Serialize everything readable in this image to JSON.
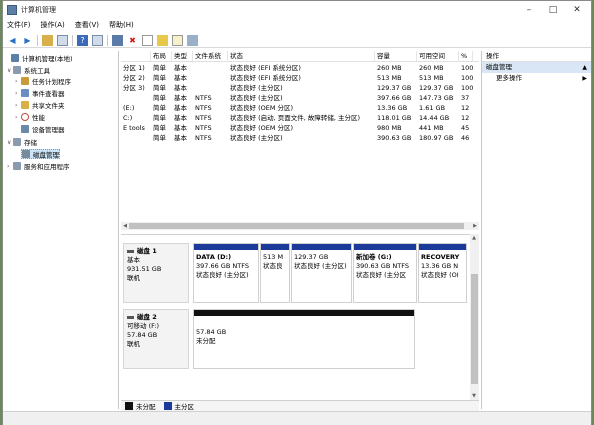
{
  "window": {
    "title": "计算机管理"
  },
  "menu": [
    "文件(F)",
    "操作(A)",
    "查看(V)",
    "帮助(H)"
  ],
  "tree": [
    {
      "label": "计算机管理(本地)",
      "level": 0,
      "color": "#5b7fa6"
    },
    {
      "label": "系统工具",
      "level": 1,
      "color": "#8a9bb0"
    },
    {
      "label": "任务计划程序",
      "level": 2,
      "color": "#c79a3a"
    },
    {
      "label": "事件查看器",
      "level": 2,
      "color": "#6b8fc4"
    },
    {
      "label": "共享文件夹",
      "level": 2,
      "color": "#d8b04a"
    },
    {
      "label": "性能",
      "level": 2,
      "color": "#c44a3a"
    },
    {
      "label": "设备管理器",
      "level": 2,
      "color": "#6a8aa8"
    },
    {
      "label": "存储",
      "level": 1,
      "color": "#8a9bb0"
    },
    {
      "label": "磁盘管理",
      "level": 2,
      "color": "#7a8a9a",
      "selected": true
    },
    {
      "label": "服务和应用程序",
      "level": 1,
      "color": "#8a9bb0"
    }
  ],
  "volume_list": {
    "headers": [
      "",
      "布局",
      "类型",
      "文件系统",
      "状态",
      "容量",
      "可用空间",
      "% "
    ],
    "rows": [
      [
        "分区 1)",
        "简单",
        "基本",
        "",
        "状态良好 (EFI 系统分区)",
        "260 MB",
        "260 MB",
        "100"
      ],
      [
        "分区 2)",
        "简单",
        "基本",
        "",
        "状态良好 (EFI 系统分区)",
        "513 MB",
        "513 MB",
        "100"
      ],
      [
        "分区 3)",
        "简单",
        "基本",
        "",
        "状态良好 (主分区)",
        "129.37 GB",
        "129.37 GB",
        "100"
      ],
      [
        "",
        "简单",
        "基本",
        "NTFS",
        "状态良好 (主分区)",
        "397.66 GB",
        "147.73 GB",
        "37"
      ],
      [
        "(E:)",
        "简单",
        "基本",
        "NTFS",
        "状态良好 (OEM 分区)",
        "13.36 GB",
        "1.61 GB",
        "12"
      ],
      [
        "C:)",
        "简单",
        "基本",
        "NTFS",
        "状态良好 (启动, 页面文件, 故障转储, 主分区)",
        "118.01 GB",
        "14.44 GB",
        "12"
      ],
      [
        "E tools",
        "简单",
        "基本",
        "NTFS",
        "状态良好 (OEM 分区)",
        "980 MB",
        "441 MB",
        "45"
      ],
      [
        "",
        "简单",
        "基本",
        "NTFS",
        "状态良好 (主分区)",
        "390.63 GB",
        "180.97 GB",
        "46"
      ]
    ]
  },
  "disks": [
    {
      "name": "磁盘 1",
      "type": "基本",
      "size": "931.51 GB",
      "status": "联机",
      "partitions": [
        {
          "name": "DATA (D:)",
          "size": "397.66 GB NTFS",
          "status": "状态良好 (主分区)",
          "color": "#1c3a9a"
        },
        {
          "name": "",
          "size": "513 M",
          "status": "状态良",
          "color": "#1c3a9a"
        },
        {
          "name": "",
          "size": "129.37 GB",
          "status": "状态良好 (主分区)",
          "color": "#1c3a9a"
        },
        {
          "name": "新加卷 (G:)",
          "size": "390.63 GB NTFS",
          "status": "状态良好 (主分区",
          "color": "#1c3a9a"
        },
        {
          "name": "RECOVERY",
          "size": "13.36 GB N",
          "status": "状态良好 (OI",
          "color": "#1c3a9a"
        }
      ]
    },
    {
      "name": "磁盘 2",
      "type": "可移动 (F:)",
      "size": "57.84 GB",
      "status": "联机",
      "partitions": [
        {
          "name": "",
          "size": "57.84 GB",
          "status": "未分配",
          "color": "#111111"
        }
      ]
    }
  ],
  "legend": [
    {
      "label": "未分配",
      "color": "#111111"
    },
    {
      "label": "主分区",
      "color": "#1c3a9a"
    }
  ],
  "actions": {
    "header": "操作",
    "section": "磁盘管理",
    "more": "更多操作"
  }
}
